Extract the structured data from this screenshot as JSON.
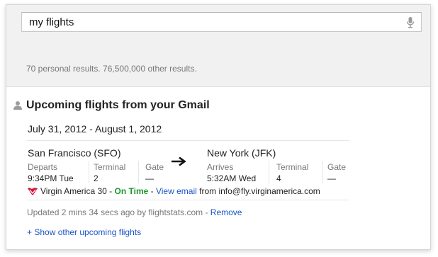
{
  "search": {
    "query": "my flights",
    "mic_icon": "microphone-icon"
  },
  "results_count": "70 personal results. 76,500,000 other results.",
  "card": {
    "person_icon": "person-icon",
    "title": "Upcoming flights from your Gmail",
    "date_range": "July 31, 2012 - August 1, 2012",
    "arrow_icon": "right-arrow-icon",
    "origin": {
      "city": "San Francisco (SFO)",
      "time_label": "Departs",
      "time_value": "9:34PM Tue",
      "terminal_label": "Terminal",
      "terminal_value": "2",
      "gate_label": "Gate",
      "gate_value": "—"
    },
    "destination": {
      "city": "New York (JFK)",
      "time_label": "Arrives",
      "time_value": "5:32AM Wed",
      "terminal_label": "Terminal",
      "terminal_value": "4",
      "gate_label": "Gate",
      "gate_value": "—"
    },
    "airline": {
      "logo_icon": "virgin-america-logo-icon",
      "flight": "Virgin America 30",
      "sep1": " - ",
      "status": "On Time",
      "sep2": " - ",
      "view_email": "View email",
      "from_text": " from info@fly.virginamerica.com"
    },
    "updated": {
      "text": "Updated 2 mins 34 secs ago by flightstats.com - ",
      "remove": "Remove"
    },
    "show_more": "+ Show other upcoming flights"
  },
  "colors": {
    "link": "#1a55c4",
    "on_time": "#1a9a2c",
    "muted": "#777777"
  }
}
